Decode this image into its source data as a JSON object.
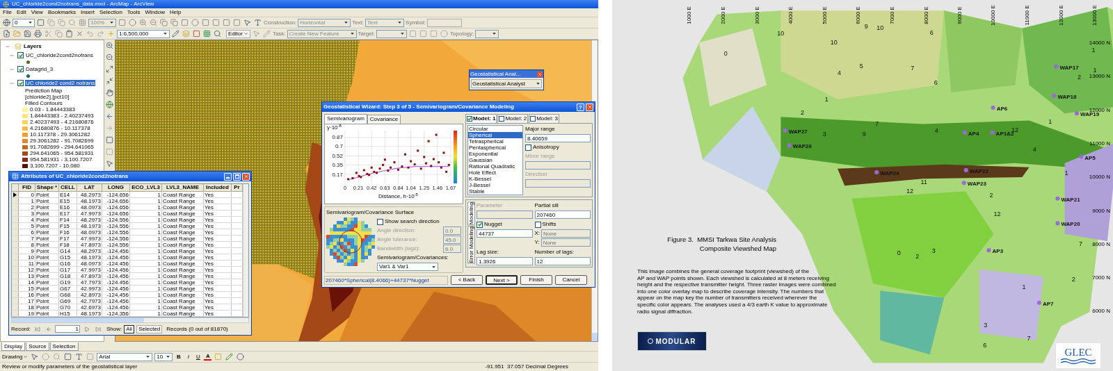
{
  "arcmap": {
    "title": "UC_chloride2cond2notrans_data.mxd - ArcMap - ArcView",
    "menu": [
      "File",
      "Edit",
      "View",
      "Bookmarks",
      "Insert",
      "Selection",
      "Tools",
      "Window",
      "Help"
    ],
    "toolbar_1": {
      "layer_combo": "0",
      "zoom_combo": "100%",
      "construction_label": "Construction:",
      "construction_value": "Horizontal",
      "text_label": "Text:",
      "text_value": "Text",
      "symbol_label": "Symbol:"
    },
    "toolbar_2": {
      "scale": "1:6,500,000",
      "editor": "Editor",
      "task_label": "Task:",
      "task_value": "Create New Feature",
      "target_label": "Target:",
      "topology_label": "Topology:"
    },
    "toc": {
      "root": "Layers",
      "layers": [
        {
          "name": "UC_chloride2cond2notrans",
          "checked": true,
          "selected": false,
          "color": "#5a6a1a"
        },
        {
          "name": "Datagrid_3",
          "checked": true,
          "selected": false,
          "color": "#1a6a5a"
        },
        {
          "name": "UC chloride2 cond2 notrans",
          "checked": true,
          "selected": true,
          "details": [
            "Prediction Map",
            "[chloride2].[pct10]",
            "Filled Contours"
          ],
          "legend": [
            {
              "label": "0.03 - 1.84443383",
              "color": "#fef59a"
            },
            {
              "label": "1.84443383 - 2.40237493",
              "color": "#fde67a"
            },
            {
              "label": "2.40237493 - 4.21680876",
              "color": "#fcd25c"
            },
            {
              "label": "4.21680876 - 10.117378",
              "color": "#f8b842"
            },
            {
              "label": "10.117378 - 29.3061282",
              "color": "#f0a030"
            },
            {
              "label": "29.3061282 - 91.7082699",
              "color": "#de8828"
            },
            {
              "label": "91.7082699 - 294.641065",
              "color": "#c46a1e"
            },
            {
              "label": "294.641065 - 954.581931",
              "color": "#a4481a"
            },
            {
              "label": "954.581931 - 3,100.7207",
              "color": "#842a12"
            },
            {
              "label": "3,100.7207 - 10,080",
              "color": "#5e0e0a"
            }
          ]
        }
      ]
    },
    "view_tabs": [
      {
        "label": "Display",
        "selected": true
      },
      {
        "label": "Source",
        "selected": false
      },
      {
        "label": "Selection",
        "selected": false
      }
    ],
    "drawing_toolbar": {
      "drawing": "Drawing",
      "font": "Arial",
      "size": "10",
      "bold": "B",
      "italic": "I",
      "underline": "U",
      "font_color": "A"
    },
    "status_bar": {
      "message": "Review or modify parameters of the geostatistical layer",
      "coordinates": "-91.951  37.057 Decimal Degrees"
    },
    "analyst_toolbar": {
      "title": "Geostatistical Anal...",
      "menu": "Geostatistical Analyst"
    },
    "attributes": {
      "title": "Attributes of UC_chloride2cond2notrans",
      "columns": [
        "FID",
        "Shape *",
        "CELL",
        "LAT",
        "LONG",
        "ECO_LVL3",
        "LVL3_NAME",
        "Included",
        "Pr"
      ],
      "rows": [
        {
          "current": true,
          "cells": [
            "0",
            "Point",
            "E14",
            "48.2973",
            "-124.656",
            "1",
            "Coast Range",
            "Yes"
          ]
        },
        {
          "current": false,
          "cells": [
            "1",
            "Point",
            "E15",
            "48.1973",
            "-124.656",
            "1",
            "Coast Range",
            "Yes"
          ]
        },
        {
          "current": false,
          "cells": [
            "2",
            "Point",
            "E16",
            "48.0973",
            "-124.656",
            "1",
            "Coast Range",
            "Yes"
          ]
        },
        {
          "current": false,
          "cells": [
            "3",
            "Point",
            "E17",
            "47.9973",
            "-124.656",
            "1",
            "Coast Range",
            "Yes"
          ]
        },
        {
          "current": false,
          "cells": [
            "4",
            "Point",
            "F14",
            "48.2973",
            "-124.556",
            "1",
            "Coast Range",
            "Yes"
          ]
        },
        {
          "current": false,
          "cells": [
            "5",
            "Point",
            "F15",
            "48.1973",
            "-124.556",
            "1",
            "Coast Range",
            "Yes"
          ]
        },
        {
          "current": false,
          "cells": [
            "6",
            "Point",
            "F16",
            "48.0973",
            "-124.556",
            "1",
            "Coast Range",
            "Yes"
          ]
        },
        {
          "current": false,
          "cells": [
            "7",
            "Point",
            "F17",
            "47.9973",
            "-124.556",
            "1",
            "Coast Range",
            "Yes"
          ]
        },
        {
          "current": false,
          "cells": [
            "8",
            "Point",
            "F18",
            "47.8973",
            "-124.556",
            "1",
            "Coast Range",
            "Yes"
          ]
        },
        {
          "current": false,
          "cells": [
            "9",
            "Point",
            "G14",
            "48.2973",
            "-124.456",
            "1",
            "Coast Range",
            "Yes"
          ]
        },
        {
          "current": false,
          "cells": [
            "10",
            "Point",
            "G15",
            "48.1973",
            "-124.456",
            "1",
            "Coast Range",
            "Yes"
          ]
        },
        {
          "current": false,
          "cells": [
            "11",
            "Point",
            "G16",
            "48.0973",
            "-124.456",
            "1",
            "Coast Range",
            "Yes"
          ]
        },
        {
          "current": false,
          "cells": [
            "12",
            "Point",
            "G17",
            "47.9973",
            "-124.456",
            "1",
            "Coast Range",
            "Yes"
          ]
        },
        {
          "current": false,
          "cells": [
            "13",
            "Point",
            "G18",
            "47.8973",
            "-124.456",
            "1",
            "Coast Range",
            "Yes"
          ]
        },
        {
          "current": false,
          "cells": [
            "14",
            "Point",
            "G19",
            "47.7973",
            "-124.456",
            "1",
            "Coast Range",
            "Yes"
          ]
        },
        {
          "current": false,
          "cells": [
            "15",
            "Point",
            "G67",
            "42.9973",
            "-124.456",
            "1",
            "Coast Range",
            "Yes"
          ]
        },
        {
          "current": false,
          "cells": [
            "16",
            "Point",
            "G68",
            "42.8973",
            "-124.456",
            "1",
            "Coast Range",
            "Yes"
          ]
        },
        {
          "current": false,
          "cells": [
            "17",
            "Point",
            "G69",
            "42.7973",
            "-124.456",
            "1",
            "Coast Range",
            "Yes"
          ]
        },
        {
          "current": false,
          "cells": [
            "18",
            "Point",
            "G70",
            "42.6973",
            "-124.456",
            "1",
            "Coast Range",
            "Yes"
          ]
        },
        {
          "current": false,
          "cells": [
            "19",
            "Point",
            "H15",
            "48.1973",
            "-124.356",
            "1",
            "Coast Range",
            "Yes"
          ]
        }
      ],
      "footer": {
        "record_label": "Record:",
        "record": "1",
        "show_label": "Show:",
        "show_options": [
          {
            "label": "All",
            "selected": true
          },
          {
            "label": "Selected",
            "selected": false
          }
        ],
        "count": "Records (0 out of 81870)"
      }
    },
    "wizard": {
      "title": "Geostatistical Wizard: Step 3 of 5 - Semivariogram/Covariance Modeling",
      "help": "?",
      "tabs": [
        {
          "label": "Semivariogram",
          "selected": true
        },
        {
          "label": "Covariance",
          "selected": false
        }
      ],
      "chart_data": {
        "type": "scatter",
        "xlabel": "Distance, h·10$^{-5}$",
        "ylabel": "γ·10$^{-8}$",
        "xlim": [
          0,
          1.67
        ],
        "ylim": [
          0,
          1
        ],
        "xticks": [
          0,
          0.21,
          0.42,
          0.63,
          0.84,
          1.04,
          1.25,
          1.46,
          1.67
        ],
        "yticks": [
          0.17,
          0.35,
          0.52,
          0.7,
          0.87
        ],
        "x": [
          0.05,
          0.12,
          0.18,
          0.22,
          0.25,
          0.3,
          0.35,
          0.38,
          0.42,
          0.46,
          0.5,
          0.55,
          0.6,
          0.63,
          0.68,
          0.72,
          0.78,
          0.84,
          0.9,
          0.95,
          1.0,
          1.04,
          1.1,
          1.15,
          1.2,
          1.25,
          1.28,
          1.32,
          1.36,
          1.4,
          1.44,
          1.48,
          1.52,
          1.56,
          1.6,
          1.64
        ],
        "grid": true,
        "series": [
          {
            "color": "#8b0a0a",
            "values": [
              0.08,
              0.1,
              0.2,
              0.14,
              0.12,
              0.25,
              0.18,
              0.16,
              0.3,
              0.22,
              0.2,
              0.28,
              0.35,
              0.45,
              0.24,
              0.3,
              0.4,
              0.26,
              0.32,
              0.55,
              0.3,
              0.42,
              0.36,
              0.62,
              0.28,
              0.5,
              0.38,
              0.8,
              0.33,
              0.46,
              0.92,
              0.4,
              0.3,
              0.58,
              0.22,
              0.35
            ]
          },
          {
            "type": "line",
            "color": "#a040f0",
            "values": [
              0.07,
              0.09,
              0.11,
              0.12,
              0.13,
              0.15,
              0.17,
              0.17,
              0.19,
              0.2,
              0.21,
              0.22,
              0.24,
              0.24,
              0.26,
              0.26,
              0.28,
              0.29,
              0.3,
              0.3,
              0.31,
              0.31,
              0.32,
              0.32,
              0.32,
              0.32,
              0.32,
              0.32,
              0.32,
              0.32,
              0.32,
              0.32,
              0.32,
              0.32,
              0.32,
              0.32
            ]
          }
        ]
      },
      "surface": {
        "title": "Semivariogram/Covariance Surface",
        "search": {
          "label": "Show search direction",
          "checked": false
        },
        "fields": [
          {
            "label": "Angle direction:",
            "value": "0.0",
            "disabled": true
          },
          {
            "label": "Angle tolerance:",
            "value": "45.0",
            "disabled": true
          },
          {
            "label": "Bandwidth (lags):",
            "value": "6.0",
            "disabled": true
          }
        ],
        "dataset_label": "Semivariogram/Covariances:",
        "dataset_value": "Var1 & Var1"
      },
      "models": [
        {
          "label": "Model: 1",
          "checked": true,
          "selected": true
        },
        {
          "label": "Model: 2",
          "checked": false,
          "selected": false
        },
        {
          "label": "Model: 3",
          "checked": false,
          "selected": false
        }
      ],
      "model_types": [
        {
          "label": "Circular",
          "selected": false
        },
        {
          "label": "Spherical",
          "selected": true
        },
        {
          "label": "Tetraspherical",
          "selected": false
        },
        {
          "label": "Pentaspherical",
          "selected": false
        },
        {
          "label": "Exponential",
          "selected": false
        },
        {
          "label": "Gaussian",
          "selected": false
        },
        {
          "label": "Rational Quadratic",
          "selected": false
        },
        {
          "label": "Hole Effect",
          "selected": false
        },
        {
          "label": "K-Bessel",
          "selected": false
        },
        {
          "label": "J-Bessel",
          "selected": false
        },
        {
          "label": "Stable",
          "selected": false
        }
      ],
      "major_range": {
        "label": "Major range",
        "value": "8.40659"
      },
      "anisotropy": {
        "label": "Anisotropy",
        "checked": false
      },
      "minor_range": {
        "label": "Minor range",
        "disabled": true
      },
      "direction": {
        "label": "Direction",
        "disabled": true
      },
      "param_tabs": [
        {
          "label": "Modeling",
          "selected": true
        },
        {
          "label": "Error Modeling",
          "selected": false
        }
      ],
      "parameter": {
        "label": "Parameter",
        "disabled": true
      },
      "partial_sill": {
        "label": "Partial sill",
        "value": "207460"
      },
      "nugget": {
        "label": "Nugget",
        "checked": true,
        "value": "44737"
      },
      "shifts": {
        "label": "Shifts",
        "checked": false
      },
      "shift_x": {
        "label": "X:",
        "value": "None"
      },
      "shift_y": {
        "label": "Y:",
        "value": "None"
      },
      "lag_size": {
        "label": "Lag size:",
        "value": "1.3926"
      },
      "lags": {
        "label": "Number of lags:",
        "value": "12"
      },
      "formula": "207460*Spherical(8.4066)+44737*Nugget",
      "buttons": [
        {
          "label": "< Back",
          "default": false
        },
        {
          "label": "Next >",
          "default": true
        },
        {
          "label": "Finish",
          "default": false
        },
        {
          "label": "Cancel",
          "default": false
        }
      ]
    }
  },
  "figure": {
    "grid_top": [
      "1000 E",
      "2000 E",
      "3000 E",
      "4000 E",
      "5000 E",
      "6000 E",
      "7000 E",
      "8000 E",
      "9000 E",
      "10000 E",
      "11000 E",
      "12000 E",
      "13000 E"
    ],
    "grid_right": [
      "14000 N",
      "13000 N",
      "12000 N",
      "11000 N",
      "10000 N",
      "9000 N",
      "8000 N",
      "7000 N",
      "6000 N"
    ],
    "map_labels": [
      {
        "text": "WAP17",
        "kind": "site"
      },
      {
        "text": "WAP18",
        "kind": "site"
      },
      {
        "text": "AP6",
        "kind": "site"
      },
      {
        "text": "WAP19",
        "kind": "site"
      },
      {
        "text": "WAP27",
        "kind": "site"
      },
      {
        "text": "AP4",
        "kind": "site"
      },
      {
        "text": "AP1&2",
        "kind": "site"
      },
      {
        "text": "WAP26",
        "kind": "site"
      },
      {
        "text": "AP5",
        "kind": "site"
      },
      {
        "text": "WAP22",
        "kind": "site"
      },
      {
        "text": "WAP24",
        "kind": "site"
      },
      {
        "text": "WAP23",
        "kind": "site"
      },
      {
        "text": "WAP21",
        "kind": "site"
      },
      {
        "text": "WAP20",
        "kind": "site"
      },
      {
        "text": "AP3",
        "kind": "site"
      },
      {
        "text": "AP7",
        "kind": "site"
      },
      {
        "text": "0",
        "kind": "count"
      },
      {
        "text": "10",
        "kind": "count"
      },
      {
        "text": "10",
        "kind": "count"
      },
      {
        "text": "9",
        "kind": "count"
      },
      {
        "text": "10",
        "kind": "count"
      },
      {
        "text": "6",
        "kind": "count"
      },
      {
        "text": "4",
        "kind": "count"
      },
      {
        "text": "5",
        "kind": "count"
      },
      {
        "text": "7",
        "kind": "count"
      },
      {
        "text": "6",
        "kind": "count"
      },
      {
        "text": "1",
        "kind": "count"
      },
      {
        "text": "2",
        "kind": "count"
      },
      {
        "text": "3",
        "kind": "count"
      },
      {
        "text": "9",
        "kind": "count"
      },
      {
        "text": "7",
        "kind": "count"
      },
      {
        "text": "4",
        "kind": "count"
      },
      {
        "text": "12",
        "kind": "count"
      },
      {
        "text": "1",
        "kind": "count"
      },
      {
        "text": "1",
        "kind": "count"
      },
      {
        "text": "1",
        "kind": "count"
      },
      {
        "text": "2",
        "kind": "count"
      },
      {
        "text": "12",
        "kind": "count"
      },
      {
        "text": "11",
        "kind": "count"
      },
      {
        "text": "12",
        "kind": "count"
      },
      {
        "text": "2",
        "kind": "count"
      },
      {
        "text": "4",
        "kind": "count"
      },
      {
        "text": "1",
        "kind": "count"
      },
      {
        "text": "0",
        "kind": "count"
      },
      {
        "text": "2",
        "kind": "count"
      },
      {
        "text": "3",
        "kind": "count"
      },
      {
        "text": "7",
        "kind": "count"
      },
      {
        "text": "2",
        "kind": "count"
      },
      {
        "text": "1",
        "kind": "count"
      },
      {
        "text": "3",
        "kind": "count"
      },
      {
        "text": "6",
        "kind": "count"
      },
      {
        "text": "7",
        "kind": "count"
      }
    ],
    "caption": [
      "Figure 3.  MMSI Tarkwa Site Analysis",
      "Composite Viewshed Map"
    ],
    "description": "This image combines the general coverage footprint (viewshed) of the\nAP and WAP points shown.  Each viewshed is calculated at 8 meters receiving\nheight and the respective transmitter height.  Three raster images were combined\ninto one color overlay map to describe coverage intensity.  The numbers that\nappear on the map key the number of transmitters received wherever the\nspecific color appears.  The analyses used a 4/3 earth K value  to approximate\nradio signal diffraction.",
    "logos": [
      {
        "kind": "modular",
        "text": "MODULAR"
      },
      {
        "kind": "glec",
        "text": "GLEC"
      }
    ]
  }
}
